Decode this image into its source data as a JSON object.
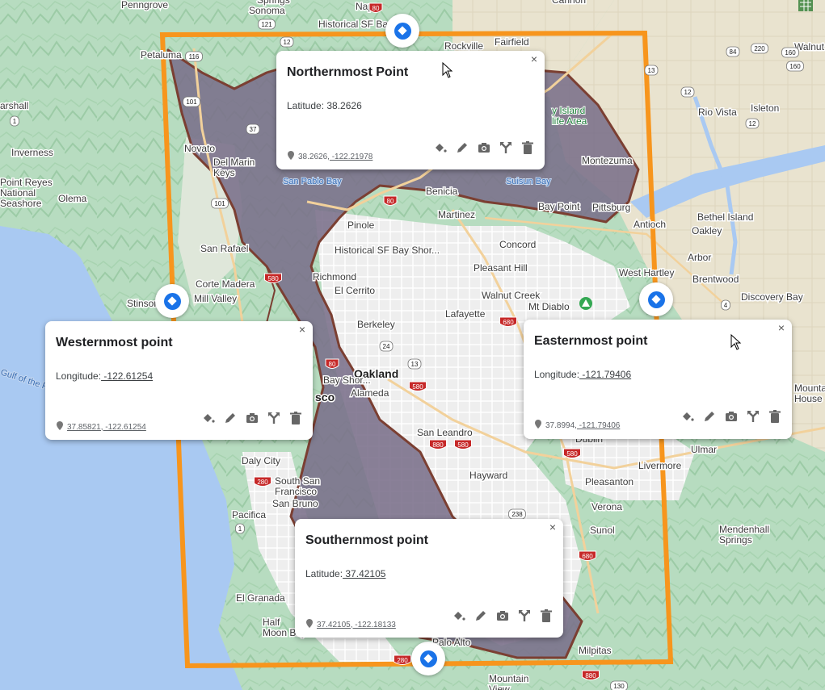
{
  "map": {
    "places": [
      {
        "id": "penngrove",
        "label": "Penngrove"
      },
      {
        "id": "sonoma",
        "label": "Sonoma"
      },
      {
        "id": "springs",
        "label": "Springs"
      },
      {
        "id": "napa",
        "label": "Napa"
      },
      {
        "id": "cannon",
        "label": "Cannon"
      },
      {
        "id": "walnut",
        "label": "Walnut"
      },
      {
        "id": "historical-sf-bay-top",
        "label": "Historical SF Ba"
      },
      {
        "id": "fairfield",
        "label": "Fairfield"
      },
      {
        "id": "rockville",
        "label": "Rockville"
      },
      {
        "id": "petaluma",
        "label": "Petaluma"
      },
      {
        "id": "marshall",
        "label": "arshall"
      },
      {
        "id": "rio-vista",
        "label": "Rio Vista"
      },
      {
        "id": "isleton",
        "label": "Isleton"
      },
      {
        "id": "inverness",
        "label": "Inverness"
      },
      {
        "id": "novato",
        "label": "Novato"
      },
      {
        "id": "del-marin-keys",
        "label": "Del Marin\nKeys"
      },
      {
        "id": "montezuma",
        "label": "Montezuma"
      },
      {
        "id": "point-reyes",
        "label": "Point Reyes\nNational\nSeashore"
      },
      {
        "id": "olema",
        "label": "Olema"
      },
      {
        "id": "benicia",
        "label": "Benicia"
      },
      {
        "id": "martinez",
        "label": "Martinez"
      },
      {
        "id": "bay-point",
        "label": "Bay Point"
      },
      {
        "id": "pittsburg",
        "label": "Pittsburg"
      },
      {
        "id": "antioch",
        "label": "Antioch"
      },
      {
        "id": "bethel-island",
        "label": "Bethel Island"
      },
      {
        "id": "oakley",
        "label": "Oakley"
      },
      {
        "id": "pinole",
        "label": "Pinole"
      },
      {
        "id": "concord",
        "label": "Concord"
      },
      {
        "id": "san-rafael",
        "label": "San Rafael"
      },
      {
        "id": "historical-sf-bay-mid",
        "label": "Historical SF Bay Shor..."
      },
      {
        "id": "pleasant-hill",
        "label": "Pleasant Hill"
      },
      {
        "id": "west-hartley",
        "label": "West Hartley"
      },
      {
        "id": "arbor",
        "label": "Arbor"
      },
      {
        "id": "corte-madera",
        "label": "Corte Madera"
      },
      {
        "id": "richmond",
        "label": "Richmond"
      },
      {
        "id": "el-cerrito",
        "label": "El Cerrito"
      },
      {
        "id": "walnut-creek",
        "label": "Walnut Creek"
      },
      {
        "id": "brentwood",
        "label": "Brentwood"
      },
      {
        "id": "stinson",
        "label": "Stinson"
      },
      {
        "id": "mill-valley",
        "label": "Mill Valley"
      },
      {
        "id": "lafayette",
        "label": "Lafayette"
      },
      {
        "id": "mt-diablo",
        "label": "Mt Diablo"
      },
      {
        "id": "discovery-bay",
        "label": "Discovery Bay"
      },
      {
        "id": "berkeley",
        "label": "Berkeley"
      },
      {
        "id": "oakland",
        "label": "Oakland"
      },
      {
        "id": "bay-shore",
        "label": "Bay Shor..."
      },
      {
        "id": "alameda",
        "label": "Alameda"
      },
      {
        "id": "sco",
        "label": "sco"
      },
      {
        "id": "gulf",
        "label": "Gulf of the Fa"
      },
      {
        "id": "san-leandro",
        "label": "San Leandro"
      },
      {
        "id": "dublin",
        "label": "Dublin"
      },
      {
        "id": "ulmar",
        "label": "Ulmar"
      },
      {
        "id": "livermore",
        "label": "Livermore"
      },
      {
        "id": "mountain-house",
        "label": "Mountain\nHouse"
      },
      {
        "id": "daly-city",
        "label": "Daly City"
      },
      {
        "id": "hayward",
        "label": "Hayward"
      },
      {
        "id": "south-sf",
        "label": "South San\nFrancisco"
      },
      {
        "id": "pleasanton",
        "label": "Pleasanton"
      },
      {
        "id": "san-bruno",
        "label": "San Bruno"
      },
      {
        "id": "pacifica",
        "label": "Pacifica"
      },
      {
        "id": "verona",
        "label": "Verona"
      },
      {
        "id": "sunol",
        "label": "Sunol"
      },
      {
        "id": "mendenhall",
        "label": "Mendenhall\nSprings"
      },
      {
        "id": "el-granada",
        "label": "El Granada"
      },
      {
        "id": "half-moon-bay",
        "label": "Half\nMoon Bay"
      },
      {
        "id": "palo-alto",
        "label": "Palo Alto"
      },
      {
        "id": "milpitas",
        "label": "Milpitas"
      },
      {
        "id": "mountain-view",
        "label": "Mountain\nView"
      }
    ],
    "water_labels": [
      {
        "id": "san-pablo-bay",
        "label": "San Pablo Bay"
      },
      {
        "id": "suisun-bay",
        "label": "Suisun Bay"
      }
    ],
    "park_labels": [
      {
        "id": "island-wildlife",
        "label": "y Island\nlife Area"
      }
    ],
    "shields": [
      {
        "id": "s116",
        "label": "116"
      },
      {
        "id": "s121",
        "label": "121"
      },
      {
        "id": "s12a",
        "label": "12"
      },
      {
        "id": "s80a",
        "label": "80"
      },
      {
        "id": "s84",
        "label": "84"
      },
      {
        "id": "s220",
        "label": "220"
      },
      {
        "id": "s160a",
        "label": "160"
      },
      {
        "id": "s160b",
        "label": "160"
      },
      {
        "id": "s12b",
        "label": "12"
      },
      {
        "id": "s12c",
        "label": "12"
      },
      {
        "id": "s13a",
        "label": "13"
      },
      {
        "id": "s101a",
        "label": "101"
      },
      {
        "id": "s37",
        "label": "37"
      },
      {
        "id": "s1a",
        "label": "1"
      },
      {
        "id": "s101b",
        "label": "101"
      },
      {
        "id": "s80b",
        "label": "80"
      },
      {
        "id": "s580a",
        "label": "580"
      },
      {
        "id": "s4",
        "label": "4"
      },
      {
        "id": "s680a",
        "label": "680"
      },
      {
        "id": "s24",
        "label": "24"
      },
      {
        "id": "s13b",
        "label": "13"
      },
      {
        "id": "s80c",
        "label": "80"
      },
      {
        "id": "s580b",
        "label": "580"
      },
      {
        "id": "s880a",
        "label": "880"
      },
      {
        "id": "s580c",
        "label": "580"
      },
      {
        "id": "s580d",
        "label": "580"
      },
      {
        "id": "s280a",
        "label": "280"
      },
      {
        "id": "s1b",
        "label": "1"
      },
      {
        "id": "s238",
        "label": "238"
      },
      {
        "id": "s680b",
        "label": "680"
      },
      {
        "id": "s880b",
        "label": "880"
      },
      {
        "id": "s280b",
        "label": "280"
      },
      {
        "id": "s130",
        "label": "130"
      }
    ]
  },
  "popups": {
    "north": {
      "title": "Northernmost Point",
      "desc_label": "Latitude: ",
      "desc_value": "38.2626",
      "coords_lat": "38.2626,",
      "coords_lng": " -122.21978"
    },
    "west": {
      "title": "Westernmost point",
      "desc_label": "Longitude:",
      "desc_value": " -122.61254",
      "coords": "37.85821, -122.61254"
    },
    "east": {
      "title": "Easternmost point",
      "desc_label": "Longitude:",
      "desc_value": " -121.79406",
      "coords_lat": "37.8994,",
      "coords_lng": " -121.79406"
    },
    "south": {
      "title": "Southernmost point",
      "desc_label": "Latitude:",
      "desc_value": " 37.42105",
      "coords": "37.42105, -122.18133"
    },
    "close_symbol": "×"
  },
  "icons": [
    "paint-bucket-icon",
    "pencil-icon",
    "camera-icon",
    "directions-icon",
    "trash-icon",
    "location-pin-icon",
    "close-icon"
  ],
  "colors": {
    "bounding_box": "#f7951d",
    "bay_area_fill": "#7a6f8a",
    "bay_area_border": "#7b3f32",
    "water": "#a9c9f2",
    "pin_blue": "#1a73e8"
  }
}
